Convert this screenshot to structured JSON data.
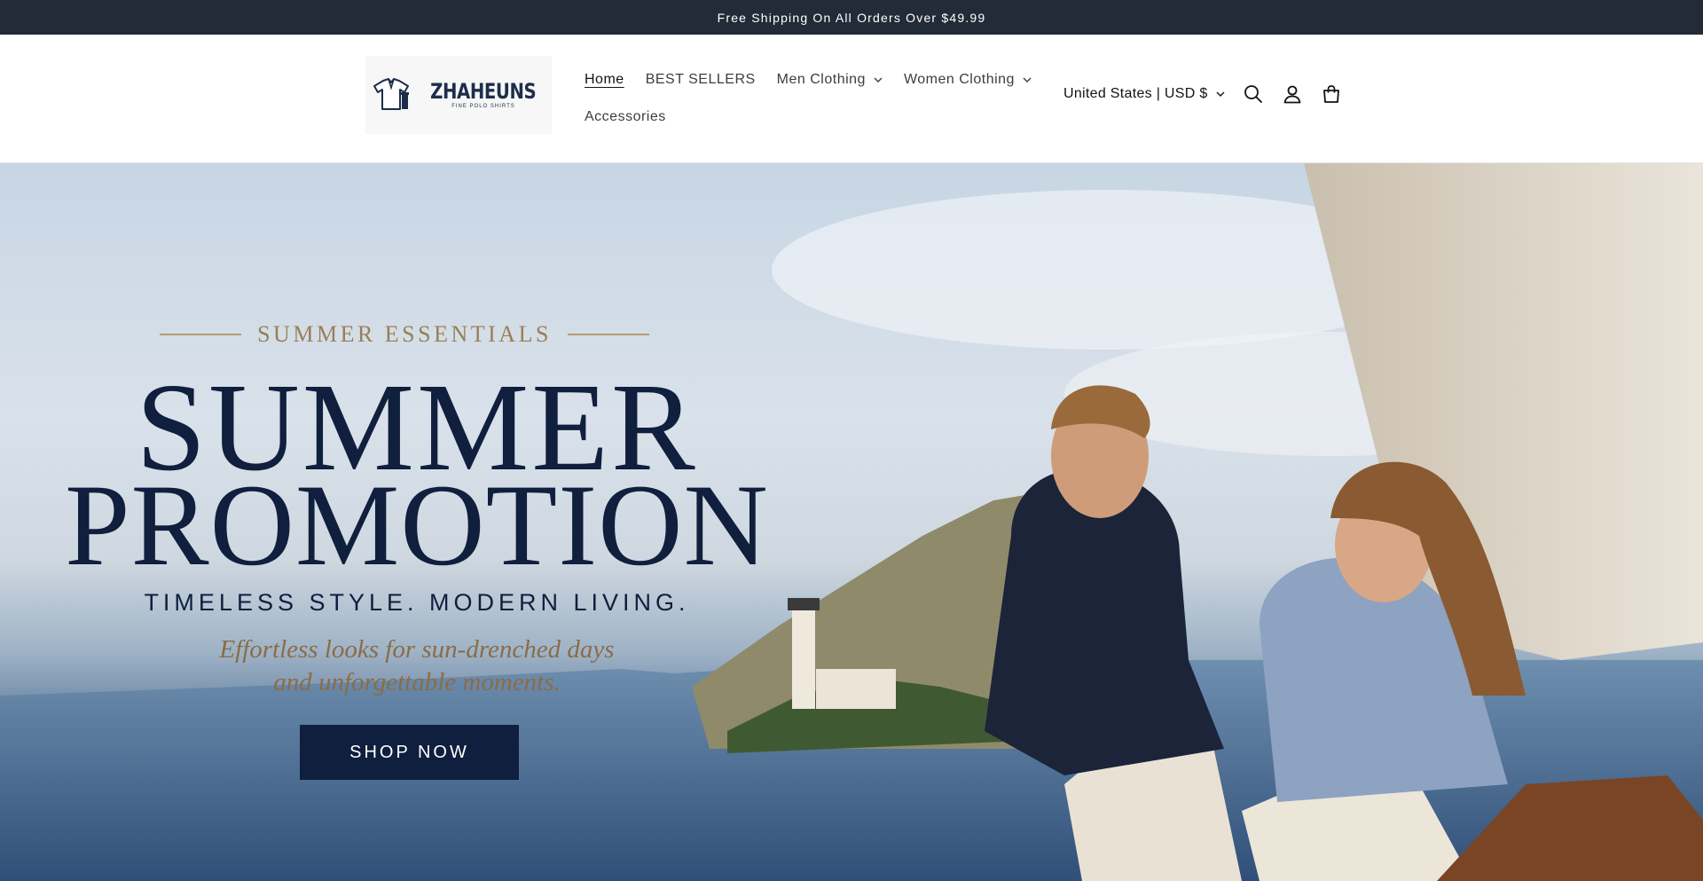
{
  "announcement": {
    "text": "Free Shipping On All Orders Over $49.99"
  },
  "brand": {
    "name": "ZHAHEUNS",
    "tagline": "FINE POLO SHIRTS",
    "color": "#1d2e4a"
  },
  "nav": {
    "items": [
      {
        "label": "Home",
        "active": true,
        "dropdown": false
      },
      {
        "label": "BEST SELLERS",
        "active": false,
        "dropdown": false
      },
      {
        "label": "Men Clothing",
        "active": false,
        "dropdown": true
      },
      {
        "label": "Women Clothing",
        "active": false,
        "dropdown": true
      },
      {
        "label": "Accessories",
        "active": false,
        "dropdown": false
      }
    ]
  },
  "header": {
    "country": "United States | USD $",
    "icons": [
      "search-icon",
      "account-icon",
      "cart-icon"
    ]
  },
  "hero": {
    "eyebrow": "SUMMER ESSENTIALS",
    "title_line1": "SUMMER",
    "title_line2": "PROMOTION",
    "tagline": "TIMELESS STYLE. MODERN LIVING.",
    "sub_line1": "Effortless looks for sun-drenched days",
    "sub_line2": "and unforgettable moments.",
    "cta": "SHOP NOW",
    "colors": {
      "navy": "#0f1f3d",
      "gold": "#9a7f55"
    }
  }
}
